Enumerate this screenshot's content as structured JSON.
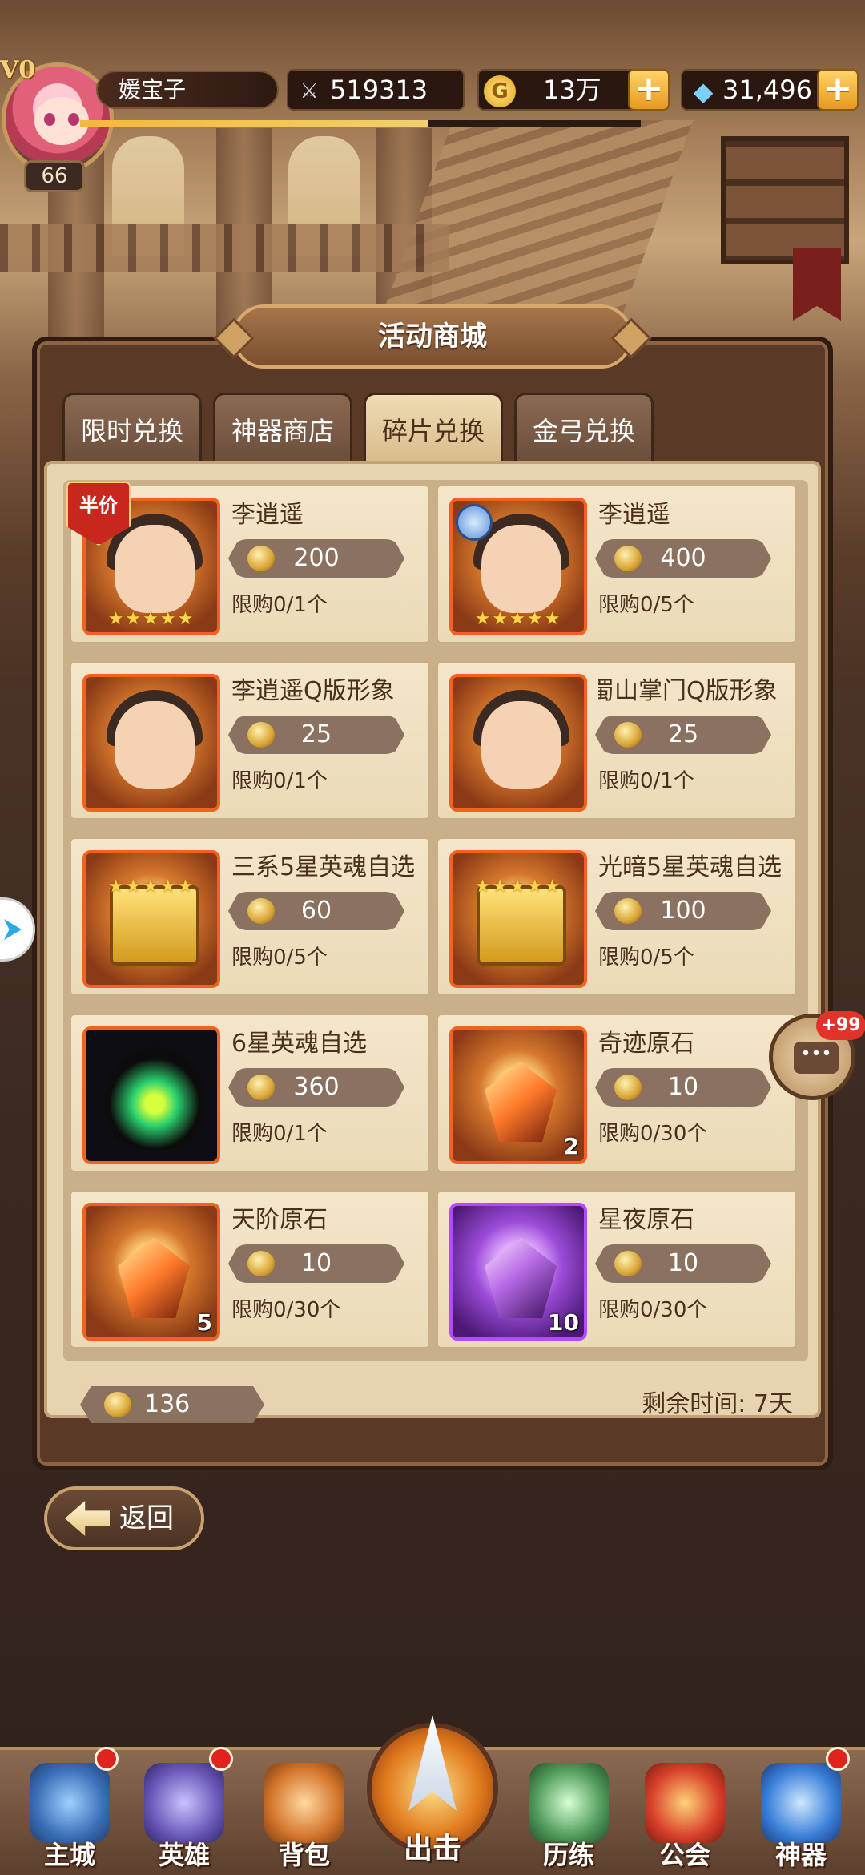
{
  "player": {
    "vip": "V0",
    "name": "媛宝子",
    "level": "66",
    "power": "519313",
    "gold": "13万",
    "diamonds": "31,496"
  },
  "shop": {
    "title": "活动商城",
    "tabs": [
      {
        "label": "限时兑换",
        "active": false
      },
      {
        "label": "神器商店",
        "active": false
      },
      {
        "label": "碎片兑换",
        "active": true
      },
      {
        "label": "金弓兑换",
        "active": false
      }
    ],
    "items": [
      {
        "name": "李逍遥",
        "price": "200",
        "limit": "限购0/1个",
        "badge": "半价",
        "stars": "★★★★★"
      },
      {
        "name": "李逍遥",
        "price": "400",
        "limit": "限购0/5个",
        "stars": "★★★★★"
      },
      {
        "name": "李逍遥Q版形象",
        "price": "25",
        "limit": "限购0/1个"
      },
      {
        "name": "蜀山掌门Q版形象",
        "price": "25",
        "limit": "限购0/1个"
      },
      {
        "name": "三系5星英魂自选",
        "price": "60",
        "limit": "限购0/5个",
        "stars": "★★★★★"
      },
      {
        "name": "光暗5星英魂自选",
        "price": "100",
        "limit": "限购0/5个",
        "stars": "★★★★★"
      },
      {
        "name": "6星英魂自选",
        "price": "360",
        "limit": "限购0/1个"
      },
      {
        "name": "奇迹原石",
        "price": "10",
        "limit": "限购0/30个",
        "count": "2"
      },
      {
        "name": "天阶原石",
        "price": "10",
        "limit": "限购0/30个",
        "count": "5"
      },
      {
        "name": "星夜原石",
        "price": "10",
        "limit": "限购0/30个",
        "count": "10"
      }
    ],
    "fragments": "136",
    "remaining_time": "剩余时间: 7天"
  },
  "back_label": "返回",
  "chat_badge": "+99",
  "nav": [
    {
      "label": "主城"
    },
    {
      "label": "英雄"
    },
    {
      "label": "背包"
    },
    {
      "label": "出击"
    },
    {
      "label": "历练"
    },
    {
      "label": "公会"
    },
    {
      "label": "神器"
    }
  ]
}
